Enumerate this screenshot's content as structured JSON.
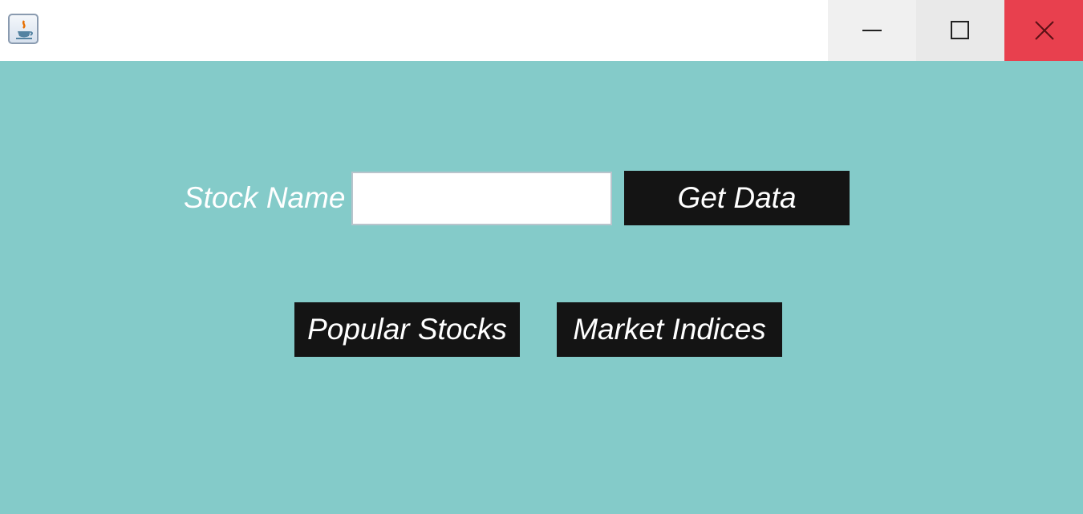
{
  "titlebar": {
    "app_icon": "java-app-icon",
    "controls": {
      "minimize_icon": "minimize-icon",
      "maximize_icon": "maximize-icon",
      "close_icon": "close-icon"
    }
  },
  "form": {
    "stock_name_label": "Stock Name",
    "stock_name_value": "",
    "get_data_label": "Get Data",
    "popular_stocks_label": "Popular Stocks",
    "market_indices_label": "Market Indices"
  },
  "colors": {
    "background": "#84cbc9",
    "button": "#141414",
    "close_button": "#e8404e"
  }
}
